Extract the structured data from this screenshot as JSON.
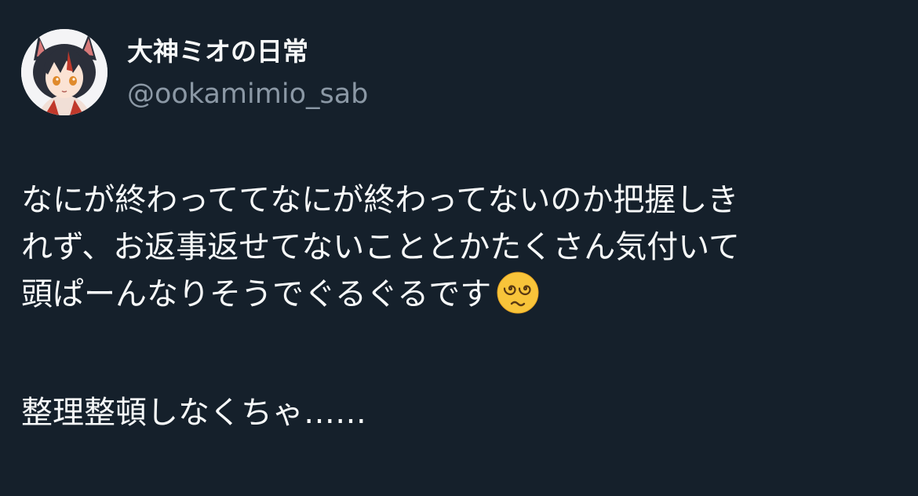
{
  "author": {
    "display_name": "大神ミオの日常",
    "handle": "@ookamimio_sab",
    "avatar": "profile-picture-anime-wolf-girl"
  },
  "tweet": {
    "lines": [
      "なにが終わっててなにが終わってないのか把握しき",
      "れず、お返事返せてないこととかたくさん気付いて",
      "頭ぱーんなりそうでぐるぐるです"
    ],
    "emoji": "dizzy-face-spiral-eyes-icon",
    "closing_line": "整理整頓しなくちゃ……"
  },
  "colors": {
    "background": "#15202b",
    "text": "#f7f9f9",
    "secondary_text": "#8b98a5",
    "emoji_face": "#f8c43a"
  }
}
